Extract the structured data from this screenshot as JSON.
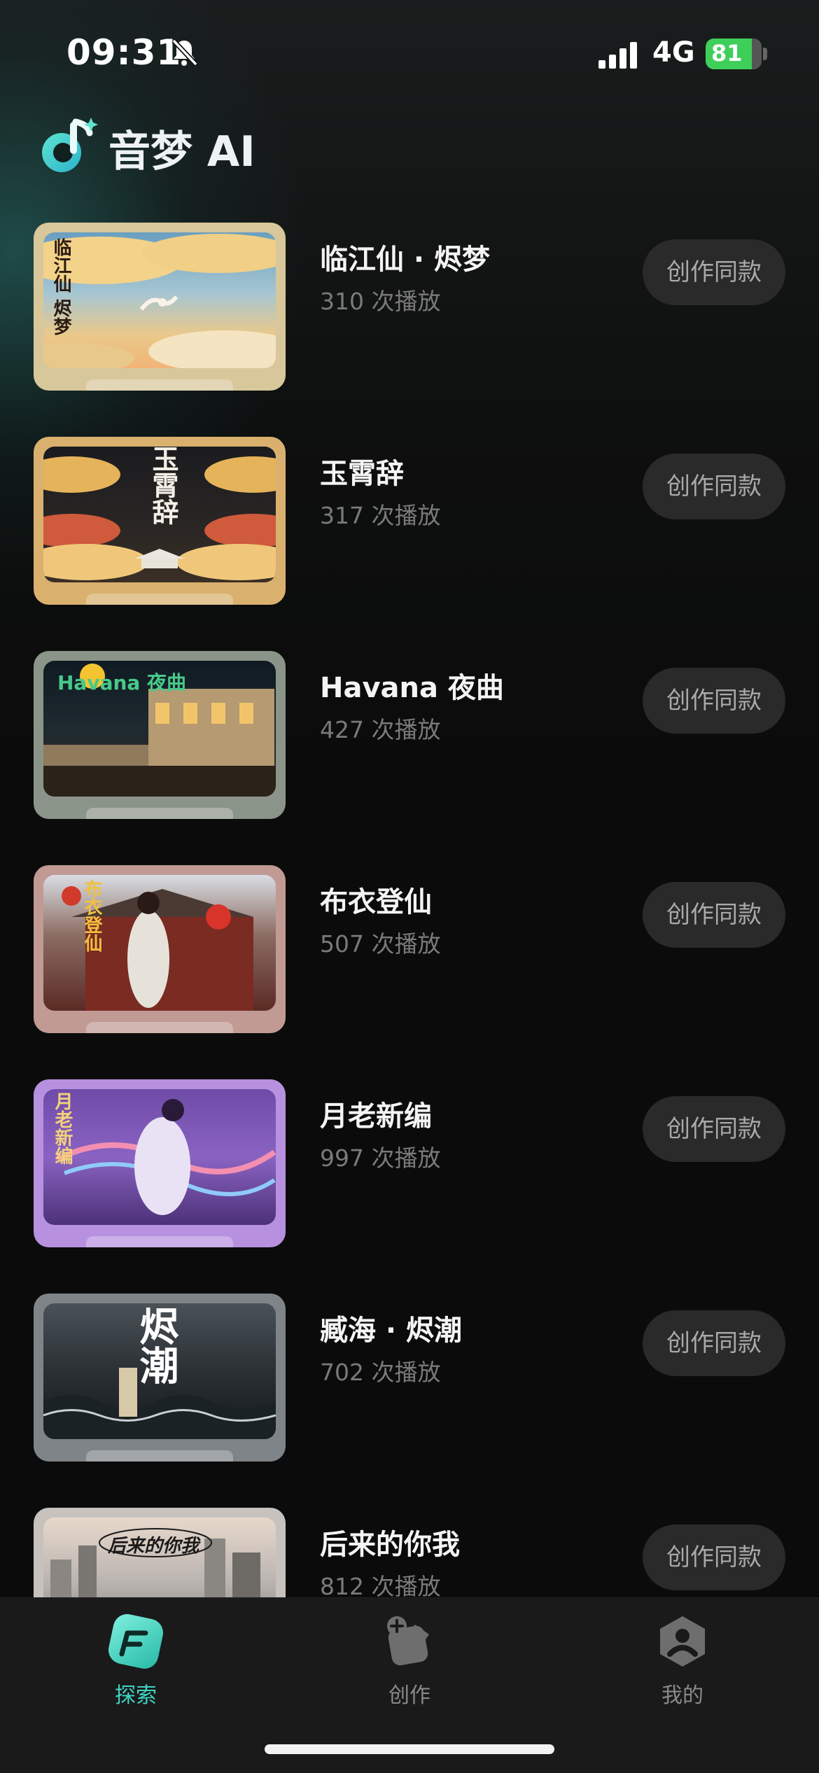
{
  "status_bar": {
    "time": "09:31",
    "network": "4G",
    "battery": "81"
  },
  "header": {
    "title": "音梦 AI"
  },
  "colors": {
    "accent": "#3ed6c4",
    "background": "#0b0b0b",
    "button_bg": "#2a2a2a",
    "battery_green": "#3ecf5a"
  },
  "songs": [
    {
      "title": "临江仙 · 烬梦",
      "plays": "310 次播放",
      "button": "创作同款",
      "poster_text": "临江仙 烬梦"
    },
    {
      "title": "玉霄辞",
      "plays": "317 次播放",
      "button": "创作同款",
      "poster_text": "玉霄辞"
    },
    {
      "title": "Havana 夜曲",
      "plays": "427 次播放",
      "button": "创作同款",
      "poster_text": "Havana 夜曲"
    },
    {
      "title": "布衣登仙",
      "plays": "507 次播放",
      "button": "创作同款",
      "poster_text": "布衣登仙"
    },
    {
      "title": "月老新编",
      "plays": "997 次播放",
      "button": "创作同款",
      "poster_text": "月老新编"
    },
    {
      "title": "臧海 · 烬潮",
      "plays": "702 次播放",
      "button": "创作同款",
      "poster_text": "烬潮"
    },
    {
      "title": "后来的你我",
      "plays": "812 次播放",
      "button": "创作同款",
      "poster_text": "后来的你我"
    }
  ],
  "tabbar": {
    "items": [
      {
        "label": "探索",
        "icon": "explore-icon",
        "active": true
      },
      {
        "label": "创作",
        "icon": "create-icon",
        "active": false
      },
      {
        "label": "我的",
        "icon": "profile-icon",
        "active": false
      }
    ]
  }
}
